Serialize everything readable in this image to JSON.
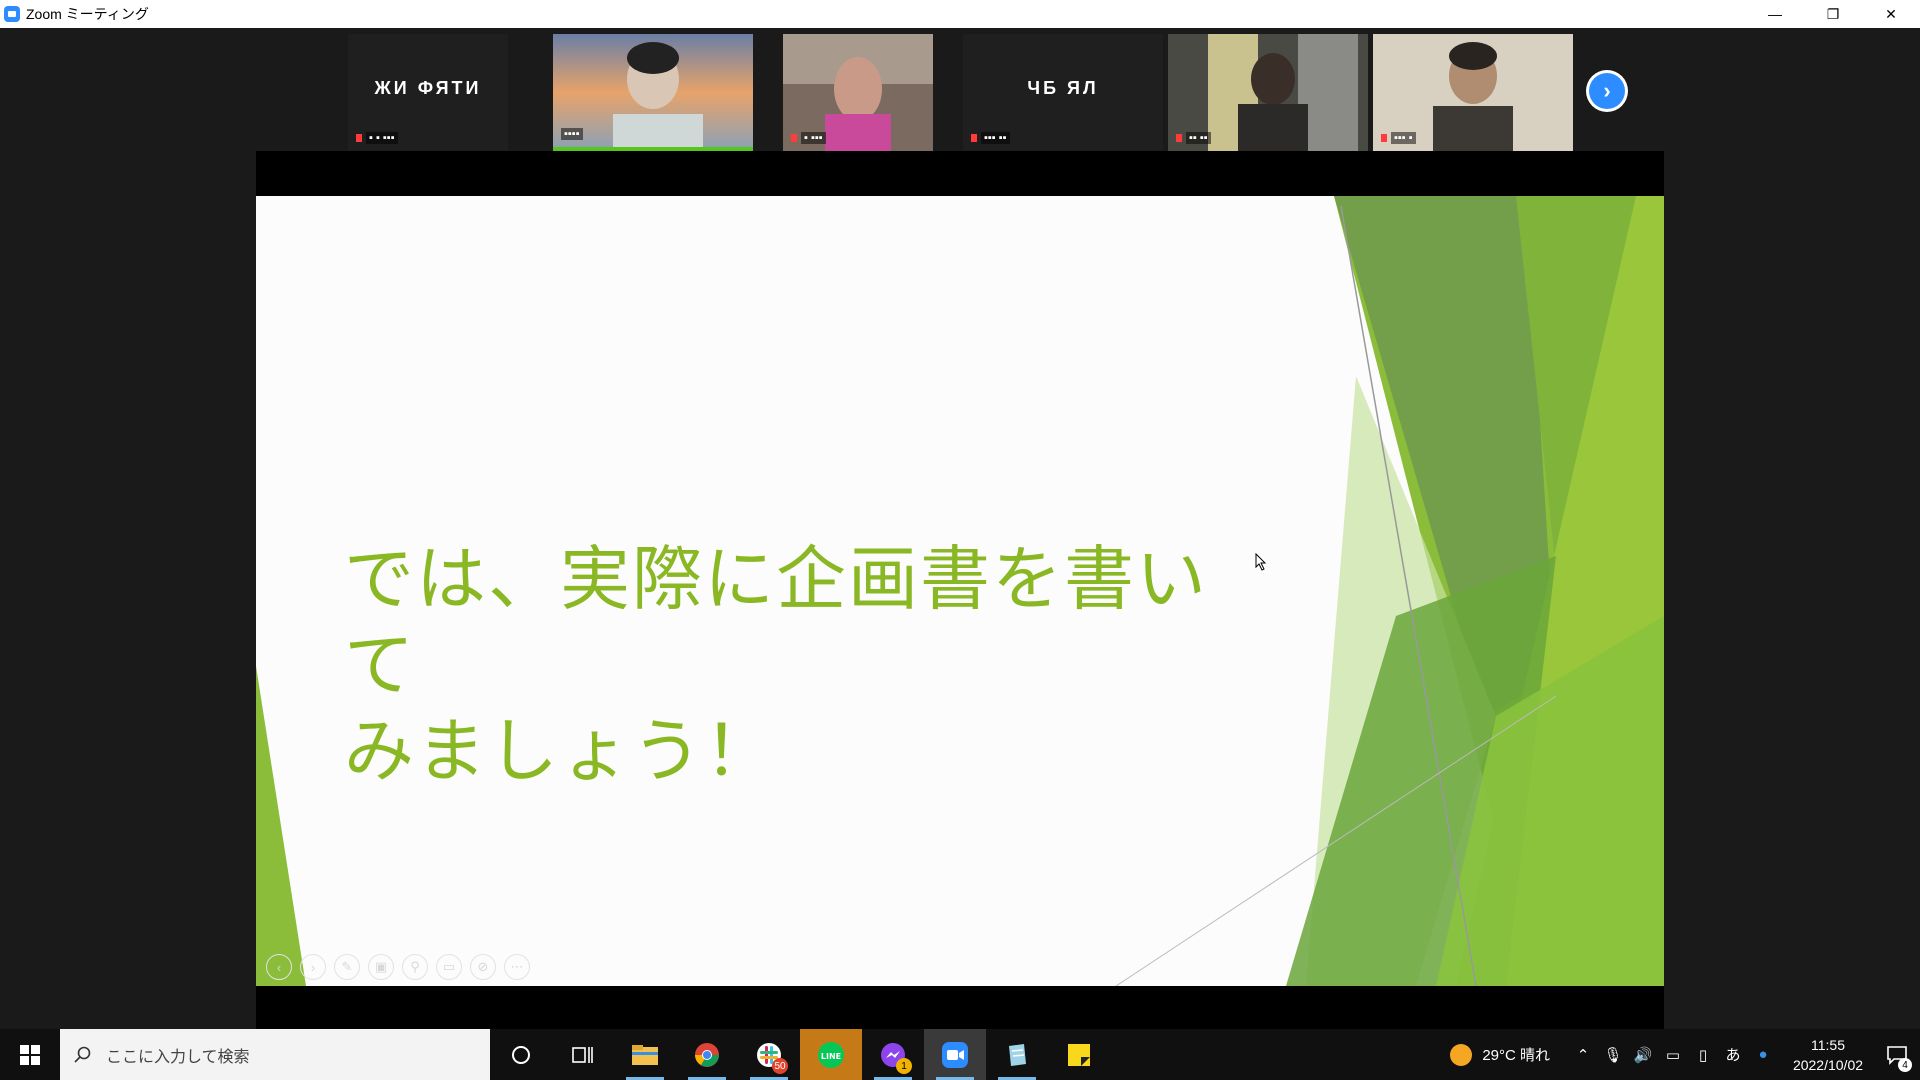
{
  "window": {
    "title": "Zoom ミーティング",
    "minimize": "—",
    "restore": "❐",
    "close": "✕"
  },
  "participants": [
    {
      "name": "ЖИ ФЯТИ",
      "tag": "▪ ▪ ▪▪▪",
      "type": "name"
    },
    {
      "name": "",
      "tag": "▪▪▪▪",
      "type": "video",
      "active": true
    },
    {
      "name": "",
      "tag": "▪ ▪▪▪",
      "type": "video"
    },
    {
      "name": "ЧБ ЯЛ",
      "tag": "▪▪▪ ▪▪",
      "type": "name"
    },
    {
      "name": "",
      "tag": "▪▪ ▪▪",
      "type": "video"
    },
    {
      "name": "",
      "tag": "▪▪▪ ▪",
      "type": "video"
    }
  ],
  "slide": {
    "line1": "では、実際に企画書を書いて",
    "line2": "みましょう！"
  },
  "slide_controls": [
    "‹",
    "›",
    "✎",
    "▣",
    "⚲",
    "▭",
    "⊘",
    "⋯"
  ],
  "taskbar": {
    "search_placeholder": "ここに入力して検索",
    "apps": [
      {
        "name": "file-explorer",
        "badge": ""
      },
      {
        "name": "chrome",
        "badge": ""
      },
      {
        "name": "slack",
        "badge": "50"
      },
      {
        "name": "line",
        "badge": ""
      },
      {
        "name": "messenger",
        "badge": "1"
      },
      {
        "name": "zoom",
        "badge": ""
      },
      {
        "name": "notepad",
        "badge": ""
      },
      {
        "name": "sticky-notes",
        "badge": ""
      }
    ],
    "weather": "29°C  晴れ",
    "ime": "あ",
    "time": "11:55",
    "date": "2022/10/02",
    "notifications": "4"
  }
}
